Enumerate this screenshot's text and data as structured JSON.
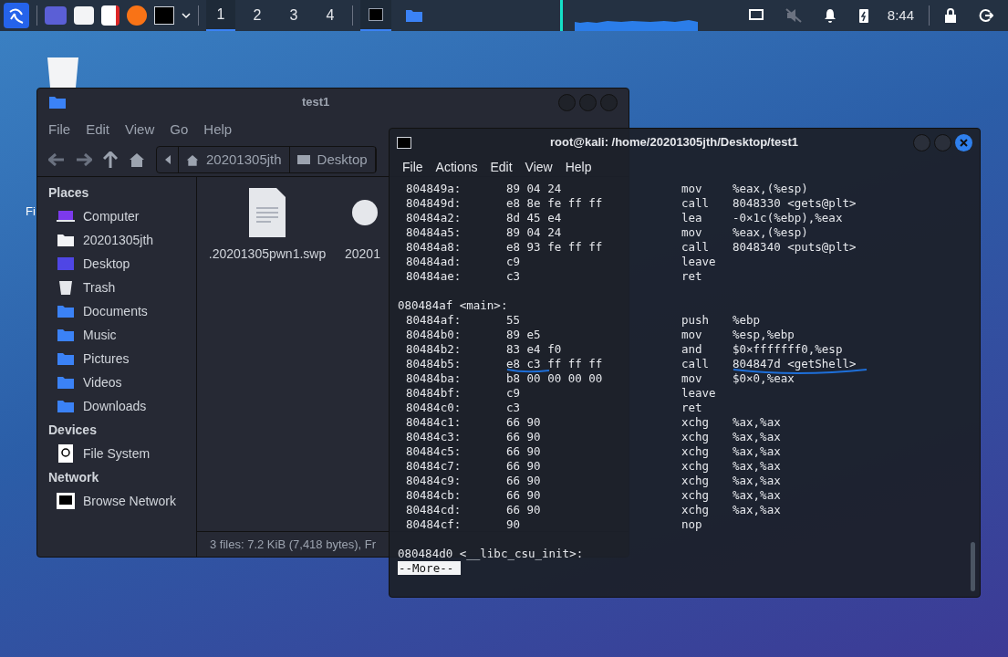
{
  "taskbar": {
    "workspaces": [
      {
        "label": "1",
        "selected": true
      },
      {
        "label": "2",
        "selected": false
      },
      {
        "label": "3",
        "selected": false
      },
      {
        "label": "4",
        "selected": false
      }
    ],
    "tasks": [
      {
        "selected": true
      },
      {
        "selected": false
      }
    ],
    "clock": "8:44"
  },
  "desktop": {
    "icon_label": "Fi"
  },
  "file_manager": {
    "title": "test1",
    "menu": [
      "File",
      "Edit",
      "View",
      "Go",
      "Help"
    ],
    "path": [
      "20201305jth",
      "Desktop"
    ],
    "sidebar": [
      {
        "heading": "Places",
        "items": [
          "Computer",
          "20201305jth",
          "Desktop",
          "Trash",
          "Documents",
          "Music",
          "Pictures",
          "Videos",
          "Downloads"
        ]
      },
      {
        "heading": "Devices",
        "items": [
          "File System"
        ]
      },
      {
        "heading": "Network",
        "items": [
          "Browse Network"
        ]
      }
    ],
    "files": [
      ".20201305pwn1.swp",
      "20201"
    ],
    "status": "3 files: 7.2 KiB (7,418 bytes), Fr"
  },
  "terminal": {
    "title": "root@kali: /home/20201305jth/Desktop/test1",
    "menu": [
      "File",
      "Actions",
      "Edit",
      "View",
      "Help"
    ],
    "lines": [
      {
        "kind": "insn",
        "address": "804849a:",
        "bytes": "89 04 24",
        "mnemonic": "mov",
        "operands": "%eax,(%esp)",
        "underline": false
      },
      {
        "kind": "insn",
        "address": "804849d:",
        "bytes": "e8 8e fe ff ff",
        "mnemonic": "call",
        "operands": "8048330 <gets@plt>",
        "underline": false
      },
      {
        "kind": "insn",
        "address": "80484a2:",
        "bytes": "8d 45 e4",
        "mnemonic": "lea",
        "operands": "-0×1c(%ebp),%eax",
        "underline": false
      },
      {
        "kind": "insn",
        "address": "80484a5:",
        "bytes": "89 04 24",
        "mnemonic": "mov",
        "operands": "%eax,(%esp)",
        "underline": false
      },
      {
        "kind": "insn",
        "address": "80484a8:",
        "bytes": "e8 93 fe ff ff",
        "mnemonic": "call",
        "operands": "8048340 <puts@plt>",
        "underline": false
      },
      {
        "kind": "insn",
        "address": "80484ad:",
        "bytes": "c9",
        "mnemonic": "leave",
        "underline": false
      },
      {
        "kind": "insn",
        "address": "80484ae:",
        "bytes": "c3",
        "mnemonic": "ret",
        "underline": false
      },
      {
        "kind": "blank"
      },
      {
        "kind": "label",
        "text": "080484af <main>:"
      },
      {
        "kind": "insn",
        "address": "80484af:",
        "bytes": "55",
        "mnemonic": "push",
        "operands": "%ebp",
        "underline": false
      },
      {
        "kind": "insn",
        "address": "80484b0:",
        "bytes": "89 e5",
        "mnemonic": "mov",
        "operands": "%esp,%ebp",
        "underline": false
      },
      {
        "kind": "insn",
        "address": "80484b2:",
        "bytes": "83 e4 f0",
        "mnemonic": "and",
        "operands": "$0×fffffff0,%esp",
        "underline": false
      },
      {
        "kind": "insn",
        "address": "80484b5:",
        "bytes": "e8 c3 ff ff ff",
        "mnemonic": "call",
        "operands": "804847d <getShell>",
        "underline": true
      },
      {
        "kind": "insn",
        "address": "80484ba:",
        "bytes": "b8 00 00 00 00",
        "mnemonic": "mov",
        "operands": "$0×0,%eax",
        "underline": false
      },
      {
        "kind": "insn",
        "address": "80484bf:",
        "bytes": "c9",
        "mnemonic": "leave",
        "underline": false
      },
      {
        "kind": "insn",
        "address": "80484c0:",
        "bytes": "c3",
        "mnemonic": "ret",
        "underline": false
      },
      {
        "kind": "insn",
        "address": "80484c1:",
        "bytes": "66 90",
        "mnemonic": "xchg",
        "operands": "%ax,%ax",
        "underline": false
      },
      {
        "kind": "insn",
        "address": "80484c3:",
        "bytes": "66 90",
        "mnemonic": "xchg",
        "operands": "%ax,%ax",
        "underline": false
      },
      {
        "kind": "insn",
        "address": "80484c5:",
        "bytes": "66 90",
        "mnemonic": "xchg",
        "operands": "%ax,%ax",
        "underline": false
      },
      {
        "kind": "insn",
        "address": "80484c7:",
        "bytes": "66 90",
        "mnemonic": "xchg",
        "operands": "%ax,%ax",
        "underline": false
      },
      {
        "kind": "insn",
        "address": "80484c9:",
        "bytes": "66 90",
        "mnemonic": "xchg",
        "operands": "%ax,%ax",
        "underline": false
      },
      {
        "kind": "insn",
        "address": "80484cb:",
        "bytes": "66 90",
        "mnemonic": "xchg",
        "operands": "%ax,%ax",
        "underline": false
      },
      {
        "kind": "insn",
        "address": "80484cd:",
        "bytes": "66 90",
        "mnemonic": "xchg",
        "operands": "%ax,%ax",
        "underline": false
      },
      {
        "kind": "insn",
        "address": "80484cf:",
        "bytes": "90",
        "mnemonic": "nop",
        "underline": false
      },
      {
        "kind": "blank"
      },
      {
        "kind": "label",
        "text": "080484d0 <__libc_csu_init>:"
      }
    ],
    "prompt": "--More--"
  }
}
